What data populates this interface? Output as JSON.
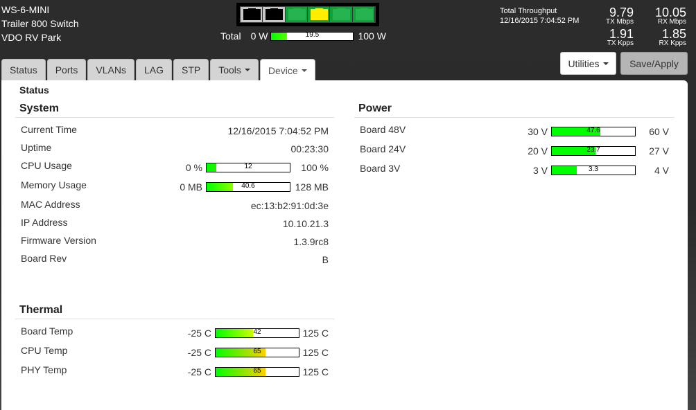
{
  "header": {
    "device_model": "WS-6-MINI",
    "device_name": "Trailer 800 Switch",
    "location": "VDO RV Park"
  },
  "ports": [
    {
      "id": 1,
      "state": "down"
    },
    {
      "id": 2,
      "state": "down"
    },
    {
      "id": 3,
      "state": "up"
    },
    {
      "id": 4,
      "state": "active"
    },
    {
      "id": 5,
      "state": "up"
    },
    {
      "id": 6,
      "state": "up"
    }
  ],
  "power_total": {
    "label": "Total",
    "min_label": "0 W",
    "max_label": "100 W",
    "value_label": "19.5",
    "value": 19.5,
    "min": 0,
    "max": 100
  },
  "throughput": {
    "title": "Total Throughput",
    "timestamp": "12/16/2015 7:04:52 PM",
    "tx_mbps": "9.79",
    "tx_mbps_label": "TX Mbps",
    "rx_mbps": "10.05",
    "rx_mbps_label": "RX Mbps",
    "tx_kpps": "1.91",
    "tx_kpps_label": "TX Kpps",
    "rx_kpps": "1.85",
    "rx_kpps_label": "RX Kpps"
  },
  "buttons": {
    "utilities": "Utilities",
    "save_apply": "Save/Apply"
  },
  "tabs": [
    {
      "label": "Status",
      "dropdown": false,
      "active": false
    },
    {
      "label": "Ports",
      "dropdown": false,
      "active": false
    },
    {
      "label": "VLANs",
      "dropdown": false,
      "active": false
    },
    {
      "label": "LAG",
      "dropdown": false,
      "active": false
    },
    {
      "label": "STP",
      "dropdown": false,
      "active": false
    },
    {
      "label": "Tools",
      "dropdown": true,
      "active": false
    },
    {
      "label": "Device",
      "dropdown": true,
      "active": true
    }
  ],
  "page_title": "Status",
  "system": {
    "title": "System",
    "current_time_label": "Current Time",
    "current_time": "12/16/2015 7:04:52 PM",
    "uptime_label": "Uptime",
    "uptime": "00:23:30",
    "cpu_label": "CPU Usage",
    "cpu": {
      "min_label": "0 %",
      "max_label": "100 %",
      "value_label": "12",
      "value": 12,
      "min": 0,
      "max": 100
    },
    "memory_label": "Memory Usage",
    "memory": {
      "min_label": "0 MB",
      "max_label": "128 MB",
      "value_label": "40.6",
      "value": 40.6,
      "min": 0,
      "max": 128
    },
    "mac_label": "MAC Address",
    "mac": "ec:13:b2:91:0d:3e",
    "ip_label": "IP Address",
    "ip": "10.10.21.3",
    "firmware_label": "Firmware Version",
    "firmware": "1.3.9rc8",
    "board_rev_label": "Board Rev",
    "board_rev": "B"
  },
  "power": {
    "title": "Power",
    "rows": [
      {
        "label": "Board 48V",
        "min_label": "30 V",
        "max_label": "60 V",
        "value_label": "47.6",
        "value": 47.6,
        "min": 30,
        "max": 60
      },
      {
        "label": "Board 24V",
        "min_label": "20 V",
        "max_label": "27 V",
        "value_label": "23.7",
        "value": 23.7,
        "min": 20,
        "max": 27
      },
      {
        "label": "Board 3V",
        "min_label": "3 V",
        "max_label": "4 V",
        "value_label": "3.3",
        "value": 3.3,
        "min": 3,
        "max": 4
      }
    ]
  },
  "thermal": {
    "title": "Thermal",
    "rows": [
      {
        "label": "Board Temp",
        "min_label": "-25 C",
        "max_label": "125 C",
        "value_label": "42",
        "value": 42,
        "min": -25,
        "max": 125
      },
      {
        "label": "CPU Temp",
        "min_label": "-25 C",
        "max_label": "125 C",
        "value_label": "65",
        "value": 65,
        "min": -25,
        "max": 125
      },
      {
        "label": "PHY Temp",
        "min_label": "-25 C",
        "max_label": "125 C",
        "value_label": "65",
        "value": 65,
        "min": -25,
        "max": 125
      }
    ]
  },
  "colors": {
    "port_up": "#12a03c",
    "port_active": "#ffee00",
    "port_down": "#c8c8c8",
    "meter_green": "#00ff00",
    "meter_yellow": "#ffdd00"
  }
}
